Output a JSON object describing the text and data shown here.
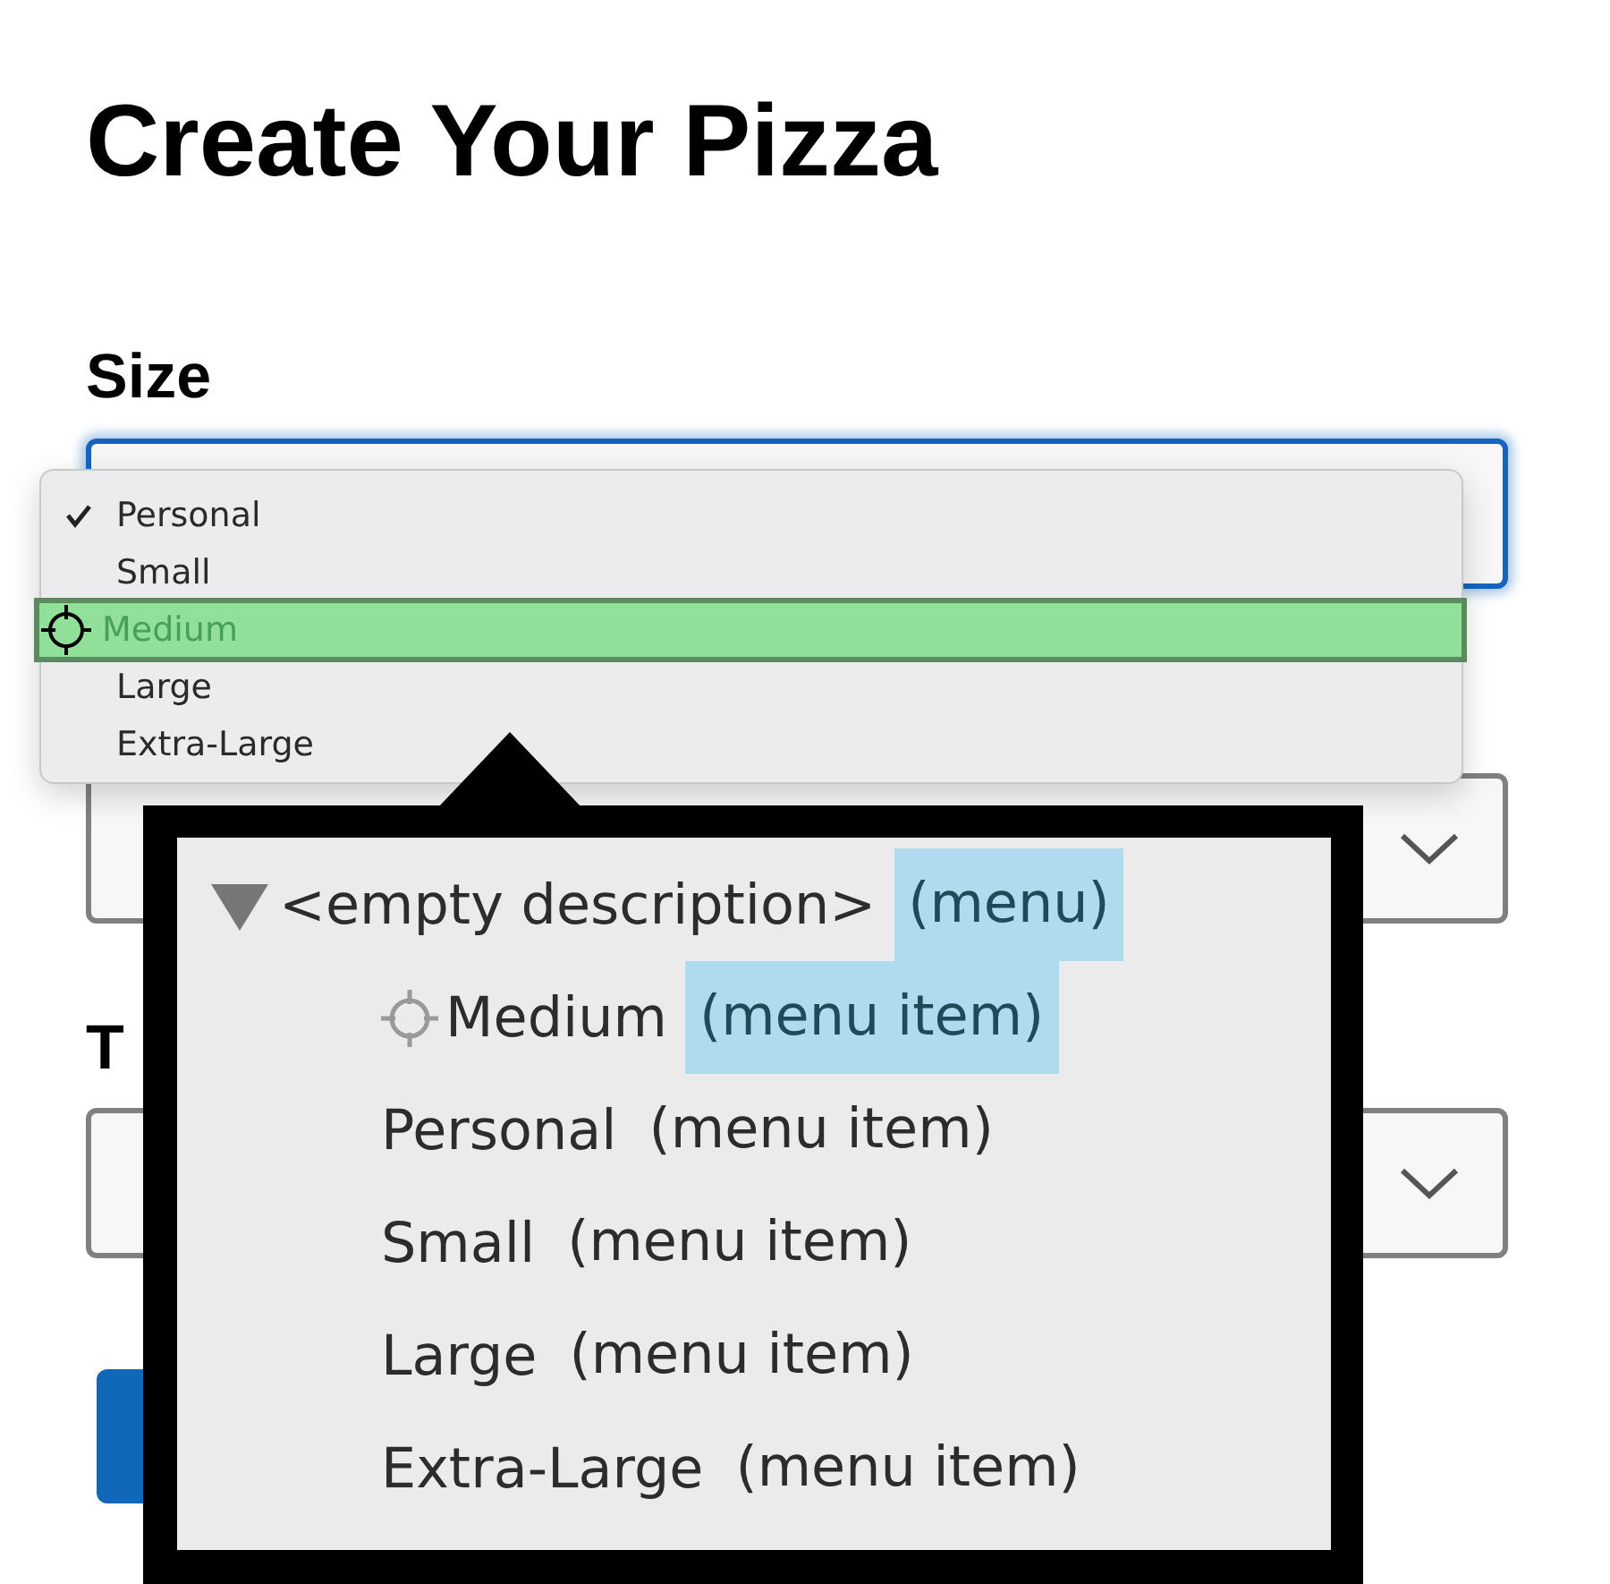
{
  "page": {
    "title": "Create Your Pizza"
  },
  "fields": [
    {
      "label": "Size",
      "focused": true,
      "chevron": false
    },
    {
      "focused": false,
      "chevron": true
    },
    {
      "label": "T",
      "focused": false,
      "chevron": true
    }
  ],
  "dropdown": {
    "items": [
      {
        "label": "Personal",
        "checked": true,
        "selected": false
      },
      {
        "label": "Small",
        "checked": false,
        "selected": false
      },
      {
        "label": "Medium",
        "checked": false,
        "selected": true
      },
      {
        "label": "Large",
        "checked": false,
        "selected": false
      },
      {
        "label": "Extra-Large",
        "checked": false,
        "selected": false
      }
    ]
  },
  "accessibility_popup": {
    "tree": {
      "name": "<empty description>",
      "role": "(menu)",
      "expanded": true,
      "highlighted": true,
      "children": [
        {
          "name": "Medium",
          "role": "(menu item)",
          "focused": true,
          "highlighted": true
        },
        {
          "name": "Personal",
          "role": "(menu item)",
          "focused": false,
          "highlighted": false
        },
        {
          "name": "Small",
          "role": "(menu item)",
          "focused": false,
          "highlighted": false
        },
        {
          "name": "Large",
          "role": "(menu item)",
          "focused": false,
          "highlighted": false
        },
        {
          "name": "Extra-Large",
          "role": "(menu item)",
          "focused": false,
          "highlighted": false
        }
      ]
    }
  }
}
